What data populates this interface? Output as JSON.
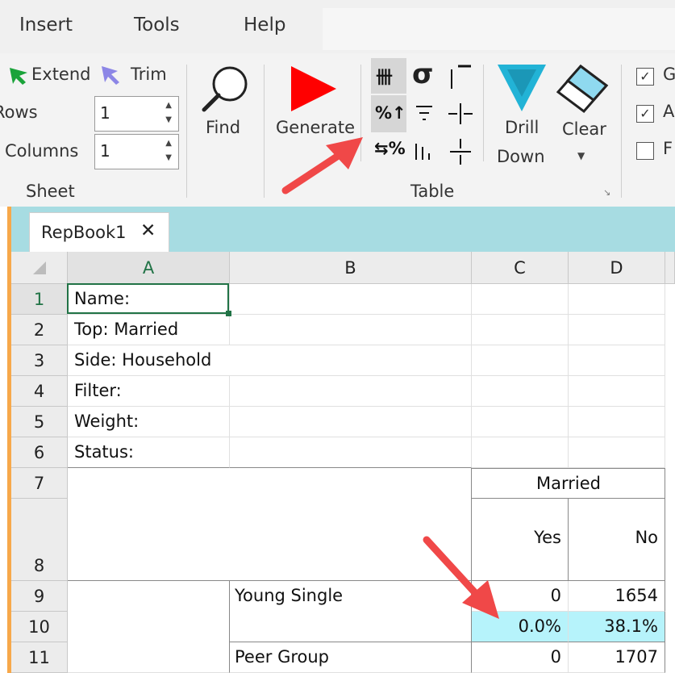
{
  "menu": {
    "items": [
      "Insert",
      "Tools",
      "Help"
    ]
  },
  "ribbon": {
    "sheet": {
      "extend_label": "Extend",
      "trim_label": "Trim",
      "rows_label": "Rows",
      "rows_value": "1",
      "columns_label": "Columns",
      "columns_value": "1",
      "group_label": "Sheet"
    },
    "find_label": "Find",
    "generate_label": "Generate",
    "drill_label_1": "Drill",
    "drill_label_2": "Down",
    "clear_label": "Clear",
    "table_group_label": "Table",
    "checkboxes": [
      {
        "label": "G",
        "checked": true
      },
      {
        "label": "A",
        "checked": true
      },
      {
        "label": "F",
        "checked": false
      }
    ]
  },
  "tabs": [
    {
      "label": "RepBook1",
      "close": "✕"
    }
  ],
  "grid": {
    "columns": [
      "A",
      "B",
      "C",
      "D"
    ],
    "rows": [
      "1",
      "2",
      "3",
      "4",
      "5",
      "6",
      "7",
      "8",
      "9",
      "10",
      "11"
    ],
    "cells": {
      "a1": "Name:",
      "a2": "Top: Married",
      "a3": "Side: Household",
      "a4": "Filter:",
      "a5": "Weight:",
      "a6": "Status:",
      "c7": "Married",
      "c8": "Yes",
      "d8": "No",
      "b9": "Young Single",
      "c9": "0",
      "d9": "1654",
      "c10": "0.0%",
      "d10": "38.1%",
      "b11": "Peer Group",
      "c11": "0",
      "d11": "1707"
    }
  },
  "colors": {
    "accent_green": "#217346",
    "tab_strip": "#a7dce2",
    "highlight": "#b6f3fb",
    "arrow": "#f04848",
    "play": "#ff0000",
    "drill": "#22b3d6"
  }
}
